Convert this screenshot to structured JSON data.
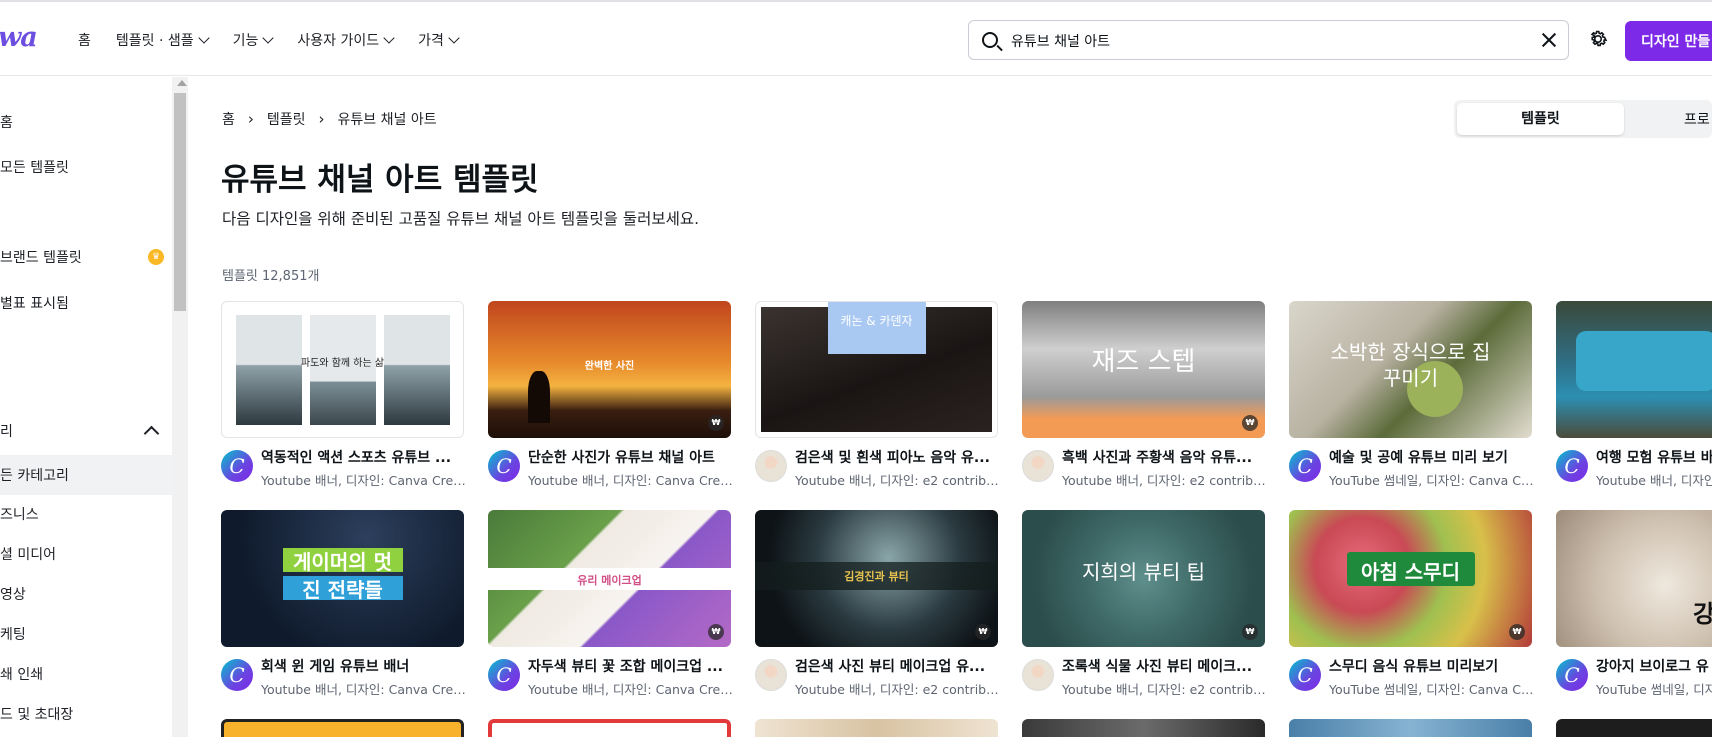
{
  "header": {
    "logo": "wa",
    "nav": [
      {
        "label": "홈",
        "has_dropdown": false
      },
      {
        "label": "템플릿 · 샘플",
        "has_dropdown": true
      },
      {
        "label": "기능",
        "has_dropdown": true
      },
      {
        "label": "사용자 가이드",
        "has_dropdown": true
      },
      {
        "label": "가격",
        "has_dropdown": true
      }
    ],
    "search": {
      "value": "유튜브 채널 아트"
    },
    "create_button": "디자인 만들"
  },
  "sidebar": {
    "items": [
      {
        "label": "홈"
      },
      {
        "label": "모든 템플릿"
      },
      {
        "label": "브랜드 템플릿"
      },
      {
        "label": "별표 표시됨"
      },
      {
        "label": "리"
      },
      {
        "label": "든 카테고리"
      },
      {
        "label": "즈니스"
      },
      {
        "label": "셜 미디어"
      },
      {
        "label": "영상"
      },
      {
        "label": "케팅"
      },
      {
        "label": "쇄 인쇄"
      },
      {
        "label": "드 및 초대장"
      }
    ]
  },
  "main": {
    "breadcrumb": [
      "홈",
      "템플릿",
      "유튜브 채널 아트"
    ],
    "toggle": {
      "active": "템플릿",
      "other": "프로"
    },
    "title": "유튜브 채널 아트 템플릿",
    "subtitle": "다음 디자인을 위해 준비된 고품질 유튜브 채널 아트 템플릿을 둘러보세요.",
    "count": "템플릿 12,851개",
    "pay_badge": "₩",
    "cards": [
      {
        "title": "역동적인 액션 스포츠 유튜브 ...",
        "sub": "Youtube 배너, 디자인: Canva Creat...",
        "avatar": "C",
        "thumb_text": "파도와 함께 하는 삶",
        "paid": false
      },
      {
        "title": "단순한 사진가 유튜브 채널 아트",
        "sub": "Youtube 배너, 디자인: Canva Creat...",
        "avatar": "C",
        "thumb_text": "완벽한 사진",
        "paid": true
      },
      {
        "title": "검은색 및 흰색 피아노 음악 유...",
        "sub": "Youtube 배너, 디자인: e2 contribut...",
        "avatar": "",
        "thumb_text": "캐논 & 카덴자",
        "paid": false
      },
      {
        "title": "흑백 사진과 주황색 음악 유튜...",
        "sub": "Youtube 배너, 디자인: e2 contribut...",
        "avatar": "",
        "thumb_text": "재즈 스텝",
        "paid": true
      },
      {
        "title": "예술 및 공예 유튜브 미리 보기",
        "sub": "YouTube 썸네일, 디자인: Canva Cr...",
        "avatar": "C",
        "thumb_text": "소박한 장식으로 집 꾸미기",
        "paid": false
      },
      {
        "title": "여행 모험 유튜브 바",
        "sub": "Youtube 배너, 디자인",
        "avatar": "C",
        "thumb_text": "",
        "paid": false
      },
      {
        "title": "회색 윈 게임 유튜브 배너",
        "sub": "Youtube 배너, 디자인: Canva Creat...",
        "avatar": "C",
        "thumb_text": "게이머의 멋진 전략들",
        "paid": false
      },
      {
        "title": "자두색 뷰티 꽃 조합 메이크업 ...",
        "sub": "Youtube 배너, 디자인: Canva Creat...",
        "avatar": "C",
        "thumb_text": "유리 메이크업",
        "paid": true
      },
      {
        "title": "검은색 사진 뷰티 메이크업 유...",
        "sub": "Youtube 배너, 디자인: e2 contribut...",
        "avatar": "",
        "thumb_text": "김경진과 뷰티",
        "paid": true
      },
      {
        "title": "조록색 식물 사진 뷰티 메이크...",
        "sub": "Youtube 배너, 디자인: e2 contribut...",
        "avatar": "",
        "thumb_text": "지희의 뷰티 팁",
        "paid": true
      },
      {
        "title": "스무디 음식 유튜브 미리보기",
        "sub": "YouTube 썸네일, 디자인: Canva Cr...",
        "avatar": "C",
        "thumb_text": "아침 스무디",
        "paid": true
      },
      {
        "title": "강아지 브이로그 유",
        "sub": "YouTube 썸네일, 디자",
        "avatar": "C",
        "thumb_text": "강",
        "paid": false
      }
    ]
  }
}
